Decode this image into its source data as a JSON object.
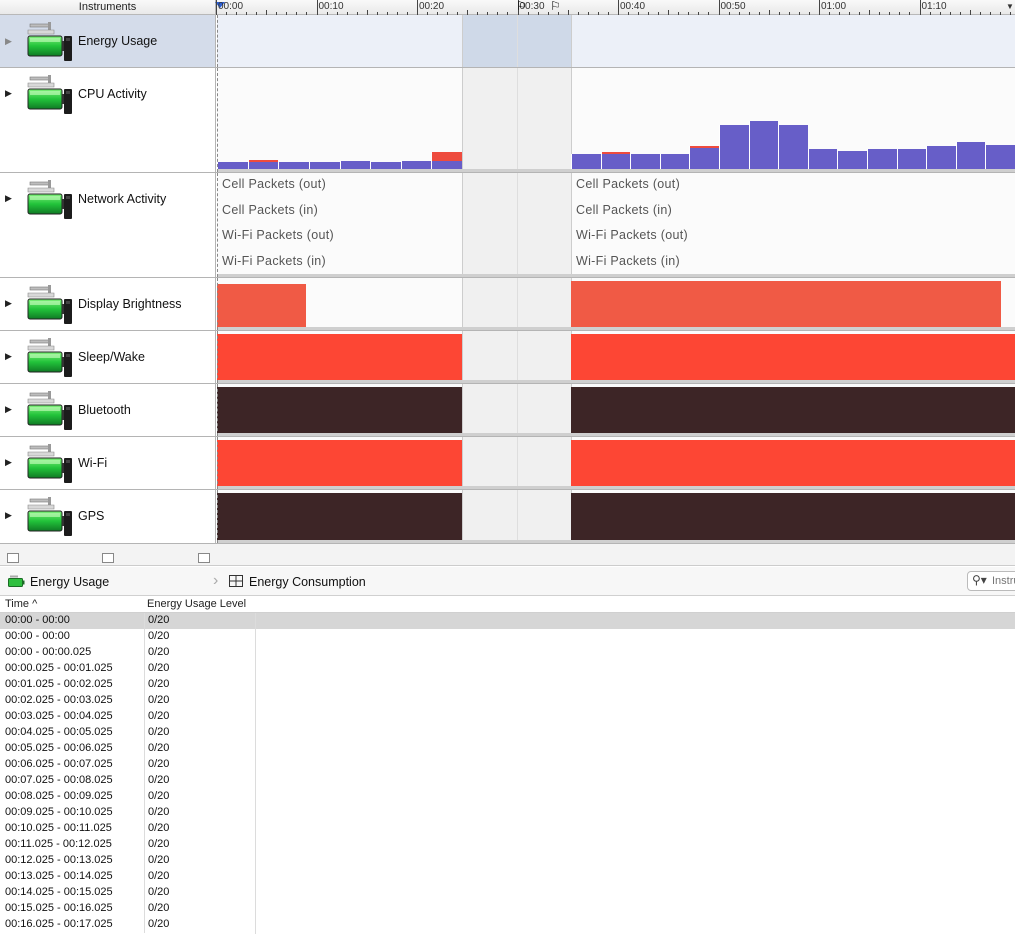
{
  "ruler": {
    "label": "Instruments",
    "ticks": [
      "00:00",
      "00:10",
      "00:20",
      "00:30",
      "00:40",
      "00:50",
      "01:00",
      "01:10"
    ]
  },
  "tracks": [
    {
      "name": "Energy Usage",
      "selected": true
    },
    {
      "name": "CPU Activity"
    },
    {
      "name": "Network Activity"
    },
    {
      "name": "Display Brightness"
    },
    {
      "name": "Sleep/Wake"
    },
    {
      "name": "Bluetooth"
    },
    {
      "name": "Wi-Fi"
    },
    {
      "name": "GPS"
    }
  ],
  "colors": {
    "cpu_bar": "#675ec8",
    "cpu_overflow": "#ee4b3e",
    "display": "#f05a45",
    "sleep_wake": "#fd4634",
    "bluetooth": "#3d2526",
    "wifi": "#fd4634",
    "gps": "#3d2526",
    "selection": "#d4dcea"
  },
  "cpu": {
    "segment1": [
      {
        "level": 0.07,
        "red": 0
      },
      {
        "level": 0.07,
        "red": 0.02
      },
      {
        "level": 0.07,
        "red": 0
      },
      {
        "level": 0.07,
        "red": 0
      },
      {
        "level": 0.08,
        "red": 0
      },
      {
        "level": 0.07,
        "red": 0
      },
      {
        "level": 0.08,
        "red": 0
      },
      {
        "level": 0.08,
        "red": 0.09
      }
    ],
    "segment2": [
      {
        "level": 0.15,
        "red": 0
      },
      {
        "level": 0.15,
        "red": 0.02
      },
      {
        "level": 0.15,
        "red": 0
      },
      {
        "level": 0.15,
        "red": 0
      },
      {
        "level": 0.21,
        "red": 0.02
      },
      {
        "level": 0.43,
        "red": 0
      },
      {
        "level": 0.47,
        "red": 0
      },
      {
        "level": 0.43,
        "red": 0
      },
      {
        "level": 0.2,
        "red": 0
      },
      {
        "level": 0.18,
        "red": 0
      },
      {
        "level": 0.2,
        "red": 0
      },
      {
        "level": 0.2,
        "red": 0
      },
      {
        "level": 0.23,
        "red": 0
      },
      {
        "level": 0.26,
        "red": 0
      },
      {
        "level": 0.24,
        "red": 0
      }
    ]
  },
  "network": {
    "labels": [
      "Cell Packets (out)",
      "Cell Packets (in)",
      "Wi-Fi Packets (out)",
      "Wi-Fi Packets (in)"
    ]
  },
  "jumpbar": {
    "instrument": "Energy Usage",
    "view": "Energy Consumption",
    "search_placeholder": "Instrument"
  },
  "table": {
    "columns": [
      "Time ^",
      "Energy Usage Level"
    ],
    "rows": [
      {
        "time": "00:00 - 00:00",
        "level": "0/20"
      },
      {
        "time": "00:00 - 00:00",
        "level": "0/20"
      },
      {
        "time": "00:00 - 00:00.025",
        "level": "0/20"
      },
      {
        "time": "00:00.025 - 00:01.025",
        "level": "0/20"
      },
      {
        "time": "00:01.025 - 00:02.025",
        "level": "0/20"
      },
      {
        "time": "00:02.025 - 00:03.025",
        "level": "0/20"
      },
      {
        "time": "00:03.025 - 00:04.025",
        "level": "0/20"
      },
      {
        "time": "00:04.025 - 00:05.025",
        "level": "0/20"
      },
      {
        "time": "00:05.025 - 00:06.025",
        "level": "0/20"
      },
      {
        "time": "00:06.025 - 00:07.025",
        "level": "0/20"
      },
      {
        "time": "00:07.025 - 00:08.025",
        "level": "0/20"
      },
      {
        "time": "00:08.025 - 00:09.025",
        "level": "0/20"
      },
      {
        "time": "00:09.025 - 00:10.025",
        "level": "0/20"
      },
      {
        "time": "00:10.025 - 00:11.025",
        "level": "0/20"
      },
      {
        "time": "00:11.025 - 00:12.025",
        "level": "0/20"
      },
      {
        "time": "00:12.025 - 00:13.025",
        "level": "0/20"
      },
      {
        "time": "00:13.025 - 00:14.025",
        "level": "0/20"
      },
      {
        "time": "00:14.025 - 00:15.025",
        "level": "0/20"
      },
      {
        "time": "00:15.025 - 00:16.025",
        "level": "0/20"
      },
      {
        "time": "00:16.025 - 00:17.025",
        "level": "0/20"
      }
    ]
  }
}
